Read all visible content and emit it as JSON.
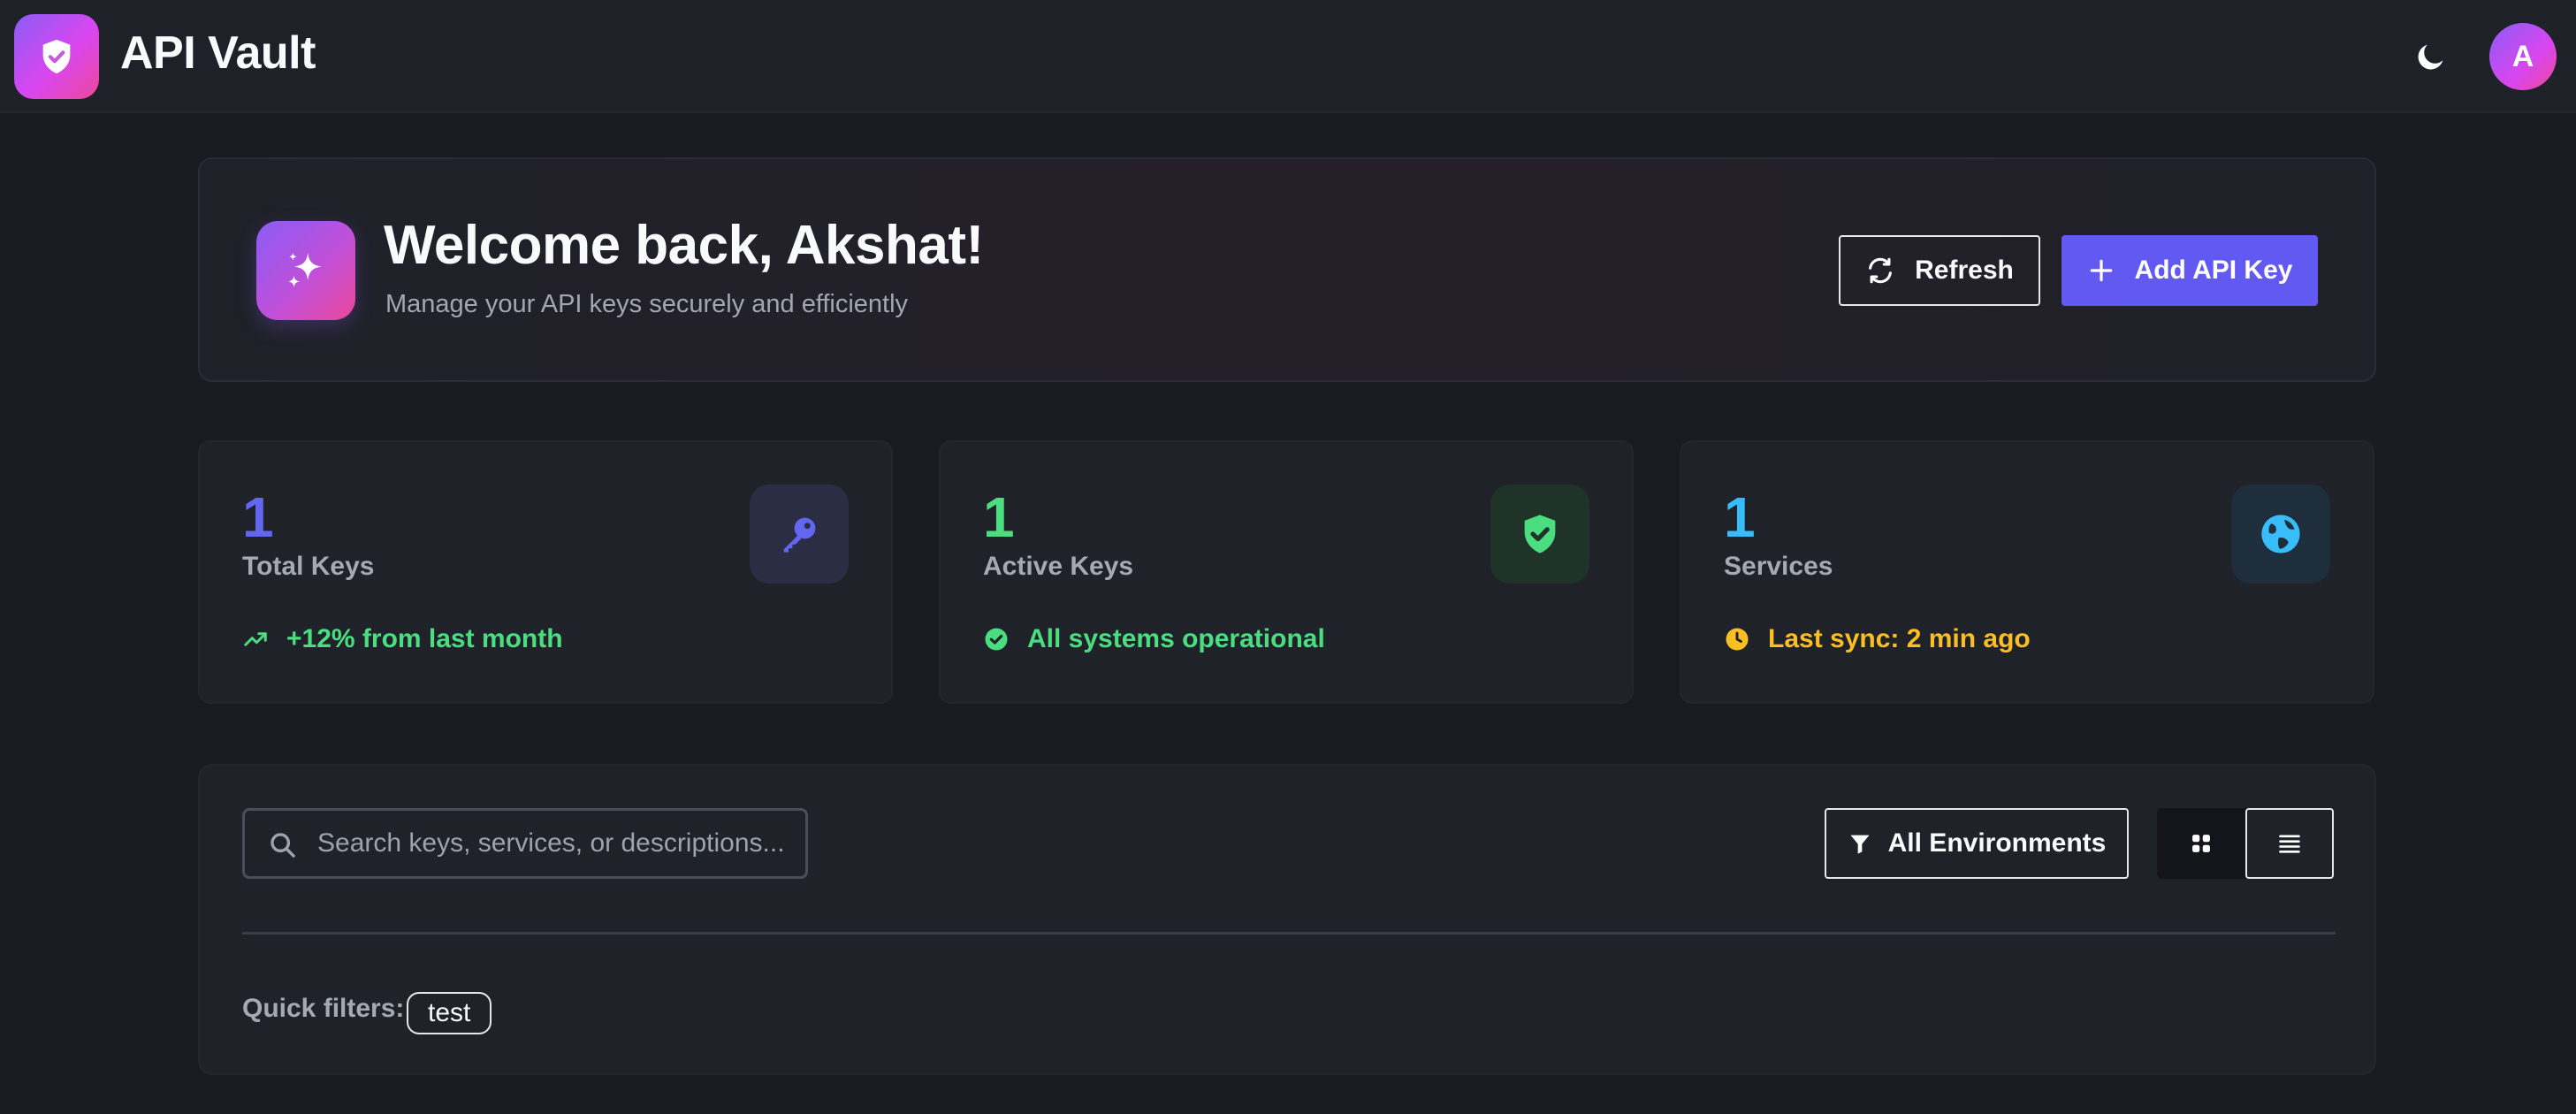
{
  "header": {
    "app_title": "API Vault",
    "logo_icon": "shield-check-icon",
    "theme_icon": "moon-icon",
    "avatar_initial": "A",
    "logo_gradient": [
      "#8b5cf6",
      "#ec4899"
    ]
  },
  "welcome": {
    "title": "Welcome back, Akshat!",
    "subtitle": "Manage your API keys securely and efficiently",
    "icon": "sparkles-icon",
    "refresh_label": "Refresh",
    "add_label": "Add API Key",
    "accent_color": "#6259f3"
  },
  "stats": [
    {
      "value": "1",
      "label": "Total Keys",
      "icon": "key-icon",
      "footer": "+12% from last month",
      "footer_icon": "trending-up-icon",
      "color": "#6366f1",
      "footer_color": "#4ade80"
    },
    {
      "value": "1",
      "label": "Active Keys",
      "icon": "shield-check-icon",
      "footer": "All systems operational",
      "footer_icon": "check-circle-icon",
      "color": "#4ade80",
      "footer_color": "#4ade80"
    },
    {
      "value": "1",
      "label": "Services",
      "icon": "globe-icon",
      "footer": "Last sync: 2 min ago",
      "footer_icon": "clock-icon",
      "color": "#38bdf8",
      "footer_color": "#fbbf24"
    }
  ],
  "filters": {
    "search_placeholder": "Search keys, services, or descriptions...",
    "search_value": "",
    "environment_label": "All Environments",
    "view_modes": [
      "grid",
      "list"
    ],
    "active_view": "list",
    "quick_filters_label": "Quick filters:",
    "quick_filters": [
      "test"
    ]
  }
}
